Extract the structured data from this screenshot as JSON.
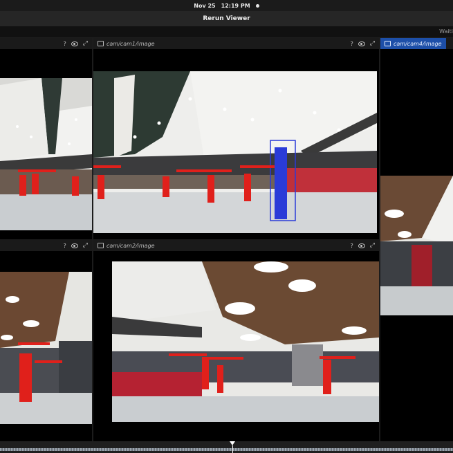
{
  "os_bar": {
    "date": "Nov 25",
    "time": "12:19 PM"
  },
  "window": {
    "title": "Rerun Viewer"
  },
  "app_bar": {
    "status": "Waiti"
  },
  "panes": {
    "top_left": {
      "help": "?"
    },
    "cam1": {
      "label": "cam/cam1/image",
      "help": "?"
    },
    "cam4": {
      "label": "cam/cam4/image"
    },
    "bottom_left": {
      "help": "?"
    },
    "cam2": {
      "label": "cam/cam2/image",
      "help": "?"
    }
  },
  "colors": {
    "accent": "#1d4fa8",
    "detection_red": "#e0201b",
    "detection_blue": "#2a3bd8"
  },
  "icons": [
    "image-icon",
    "help-icon",
    "eye-icon",
    "expand-icon",
    "status-dot-icon",
    "timeline-marker-icon"
  ]
}
